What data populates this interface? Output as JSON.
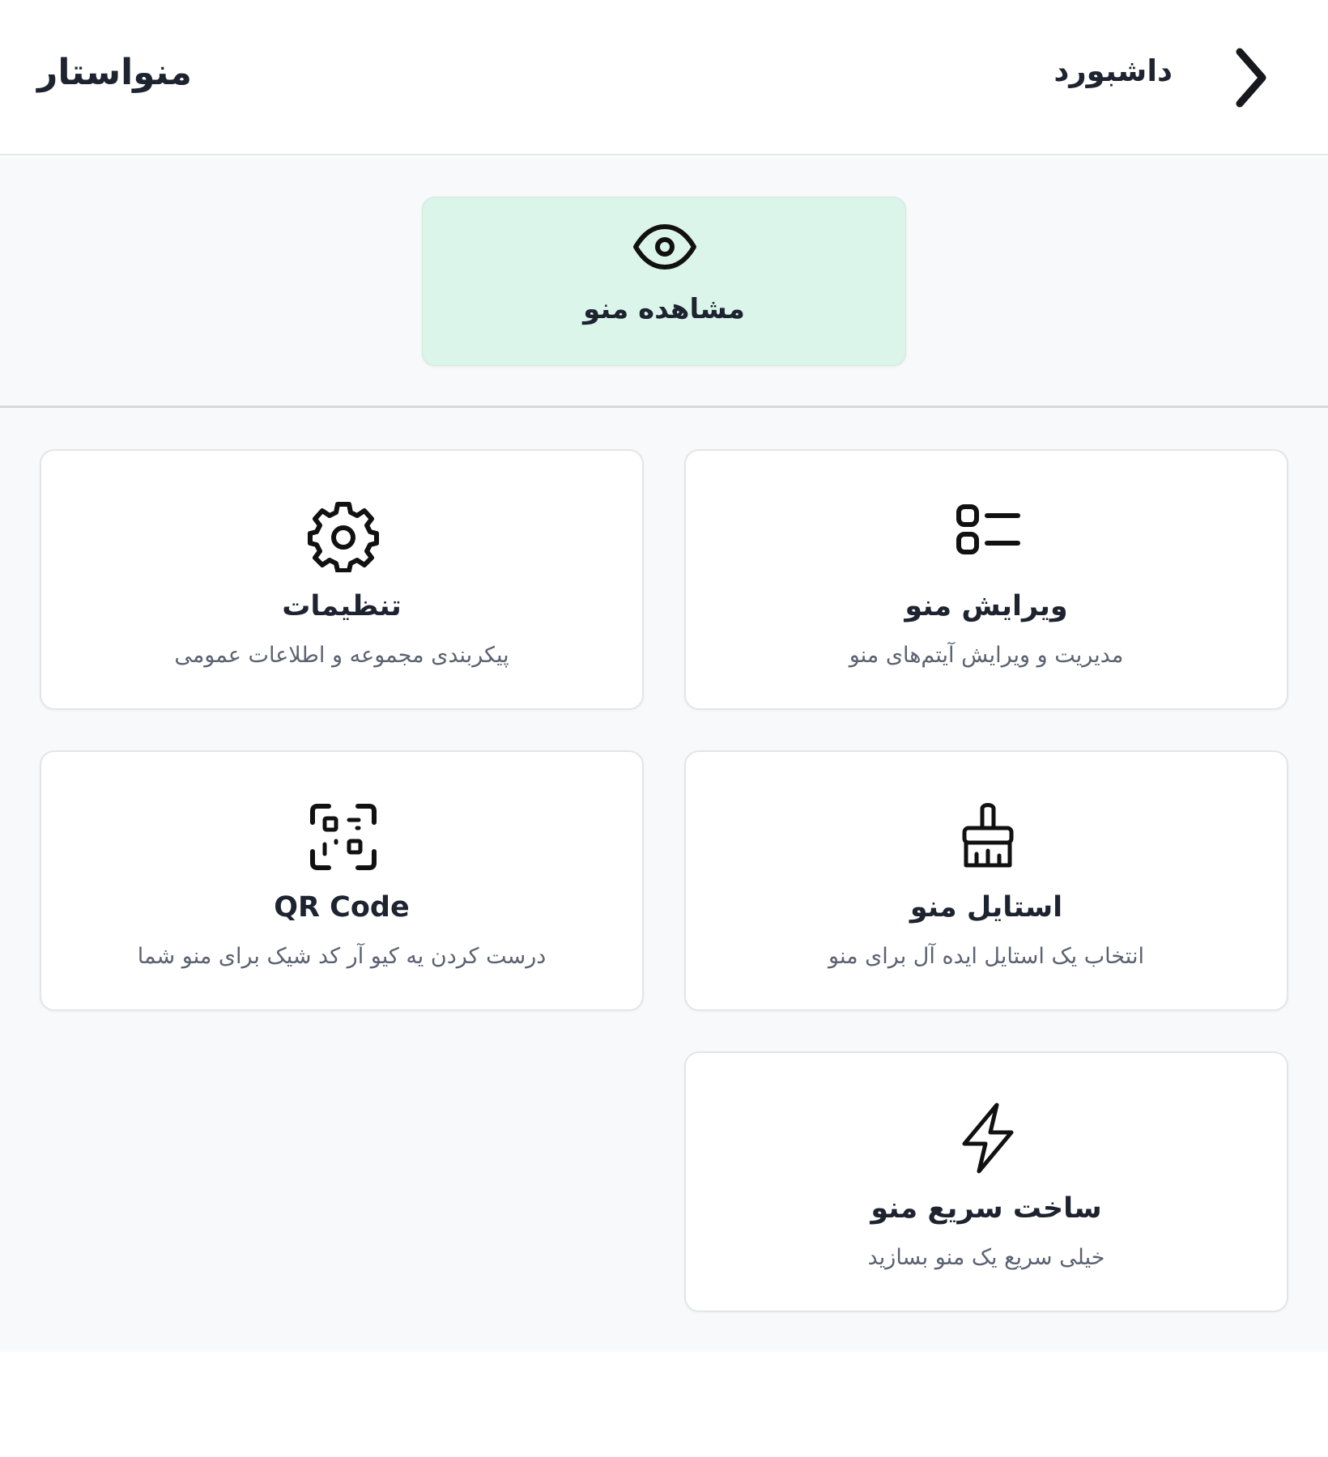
{
  "header": {
    "brand": "منواستار",
    "back_label": "داشبورد"
  },
  "view_menu": {
    "label": "مشاهده منو",
    "icon": "eye-icon"
  },
  "cards": {
    "edit": {
      "title": "ویرایش منو",
      "desc": "مدیریت و ویرایش آیتم‌های منو",
      "icon": "list-icon"
    },
    "settings": {
      "title": "تنظیمات",
      "desc": "پیکربندی مجموعه و اطلاعات عمومی",
      "icon": "gear-icon"
    },
    "style": {
      "title": "استایل منو",
      "desc": "انتخاب یک استایل ایده آل برای منو",
      "icon": "brush-icon"
    },
    "qr": {
      "title": "QR Code",
      "desc": "درست کردن یه کیو آر کد شیک برای منو شما",
      "icon": "qr-code-icon"
    },
    "quick": {
      "title": "ساخت سریع منو",
      "desc": "خیلی سریع یک منو بسازید",
      "icon": "lightning-icon"
    }
  },
  "colors": {
    "view_card_bg": "#dcf5ea",
    "page_bg": "#f8f9fa",
    "text": "#1e2330",
    "muted": "#5b6270"
  }
}
